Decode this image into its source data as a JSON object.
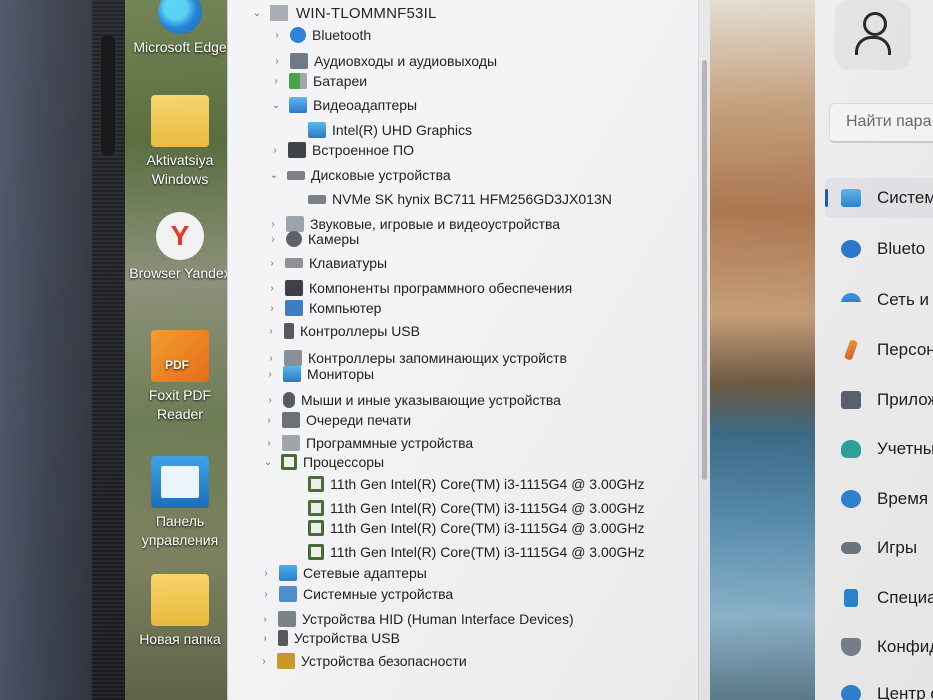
{
  "desktop": {
    "icons": [
      {
        "label": "Microsoft Edge",
        "icon": "edge-icon"
      },
      {
        "label": "Aktivatsiya Windows",
        "icon": "folder-icon"
      },
      {
        "label": "Browser Yandex",
        "icon": "yandex-browser-icon"
      },
      {
        "label": "Foxit PDF Reader",
        "icon": "foxit-pdf-icon"
      },
      {
        "label": "Панель управления",
        "icon": "control-panel-icon"
      },
      {
        "label": "Новая папка",
        "icon": "folder-icon"
      }
    ]
  },
  "device_manager": {
    "root": "WIN-TLOMMNF53IL",
    "categories": [
      {
        "label": "Bluetooth",
        "icon": "bluetooth-icon",
        "expanded": false
      },
      {
        "label": "Аудиовходы и аудиовыходы",
        "icon": "audio-icon",
        "expanded": false
      },
      {
        "label": "Батареи",
        "icon": "battery-icon",
        "expanded": false
      },
      {
        "label": "Видеоадаптеры",
        "icon": "display-adapter-icon",
        "expanded": true
      },
      {
        "label": "Intel(R) UHD Graphics",
        "icon": "display-adapter-icon",
        "child": true
      },
      {
        "label": "Встроенное ПО",
        "icon": "firmware-icon",
        "expanded": false
      },
      {
        "label": "Дисковые устройства",
        "icon": "disk-icon",
        "expanded": true
      },
      {
        "label": "NVMe SK hynix BC711 HFM256GD3JX013N",
        "icon": "disk-icon",
        "child": true
      },
      {
        "label": "Звуковые, игровые и видеоустройства",
        "icon": "sound-icon",
        "expanded": false
      },
      {
        "label": "Камеры",
        "icon": "camera-icon",
        "expanded": false
      },
      {
        "label": "Клавиатуры",
        "icon": "keyboard-icon",
        "expanded": false
      },
      {
        "label": "Компоненты программного обеспечения",
        "icon": "software-component-icon",
        "expanded": false
      },
      {
        "label": "Компьютер",
        "icon": "computer-icon",
        "expanded": false
      },
      {
        "label": "Контроллеры USB",
        "icon": "usb-icon",
        "expanded": false
      },
      {
        "label": "Контроллеры запоминающих устройств",
        "icon": "storage-controller-icon",
        "expanded": false
      },
      {
        "label": "Мониторы",
        "icon": "monitor-icon",
        "expanded": false
      },
      {
        "label": "Мыши и иные указывающие устройства",
        "icon": "mouse-icon",
        "expanded": false
      },
      {
        "label": "Очереди печати",
        "icon": "printer-icon",
        "expanded": false
      },
      {
        "label": "Программные устройства",
        "icon": "software-device-icon",
        "expanded": false
      },
      {
        "label": "Процессоры",
        "icon": "cpu-icon",
        "expanded": true
      },
      {
        "label": "11th Gen Intel(R) Core(TM) i3-1115G4 @ 3.00GHz",
        "icon": "cpu-icon",
        "child": true
      },
      {
        "label": "11th Gen Intel(R) Core(TM) i3-1115G4 @ 3.00GHz",
        "icon": "cpu-icon",
        "child": true
      },
      {
        "label": "11th Gen Intel(R) Core(TM) i3-1115G4 @ 3.00GHz",
        "icon": "cpu-icon",
        "child": true
      },
      {
        "label": "11th Gen Intel(R) Core(TM) i3-1115G4 @ 3.00GHz",
        "icon": "cpu-icon",
        "child": true
      },
      {
        "label": "Сетевые адаптеры",
        "icon": "network-adapter-icon",
        "expanded": false
      },
      {
        "label": "Системные устройства",
        "icon": "system-device-icon",
        "expanded": false
      },
      {
        "label": "Устройства HID (Human Interface Devices)",
        "icon": "hid-icon",
        "expanded": false
      },
      {
        "label": "Устройства USB",
        "icon": "usb-icon",
        "expanded": false
      },
      {
        "label": "Устройства безопасности",
        "icon": "security-device-icon",
        "expanded": false
      }
    ]
  },
  "settings": {
    "search_placeholder": "Найти пара",
    "nav": [
      {
        "label": "Систем",
        "icon": "system-icon",
        "active": true
      },
      {
        "label": "Blueto",
        "icon": "bluetooth-icon"
      },
      {
        "label": "Сеть и",
        "icon": "wifi-icon"
      },
      {
        "label": "Персон",
        "icon": "brush-icon"
      },
      {
        "label": "Прилож",
        "icon": "apps-icon"
      },
      {
        "label": "Учетны",
        "icon": "accounts-icon"
      },
      {
        "label": "Время и",
        "icon": "time-language-icon"
      },
      {
        "label": "Игры",
        "icon": "gamepad-icon"
      },
      {
        "label": "Специал",
        "icon": "accessibility-icon"
      },
      {
        "label": "Конфиде",
        "icon": "privacy-shield-icon"
      },
      {
        "label": "Центр об",
        "icon": "update-icon"
      }
    ]
  }
}
